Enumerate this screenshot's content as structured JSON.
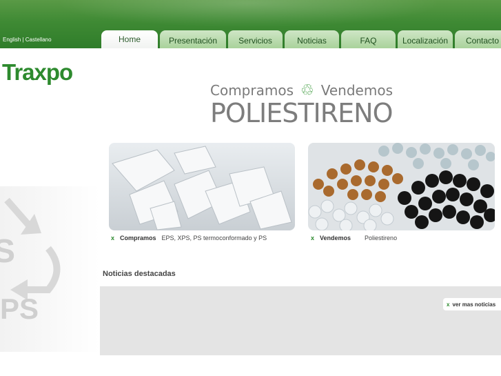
{
  "lang": {
    "english": "English",
    "sep": " | ",
    "castellano": "Castellano"
  },
  "tabs": [
    {
      "label": "Home",
      "active": true
    },
    {
      "label": "Presentación"
    },
    {
      "label": "Servicios"
    },
    {
      "label": "Noticias"
    },
    {
      "label": "FAQ"
    },
    {
      "label": "Localización"
    },
    {
      "label": "Contacto"
    }
  ],
  "logo": "Traxpo",
  "hero": {
    "buy": "Compramos",
    "sell": "Vendemos",
    "product": "POLIESTIRENO",
    "icon": "recycle-icon"
  },
  "cards": [
    {
      "bold": "Compramos",
      "text": "EPS, XPS, PS termoconformado y PS"
    },
    {
      "bold": "Vendemos",
      "text": "Poliestireno"
    }
  ],
  "news": {
    "title": "Noticias destacadas",
    "more": "ver mas noticias"
  },
  "watermark": {
    "top": "S",
    "bottom": "PS"
  },
  "colors": {
    "brand": "#2d8a2e",
    "header": "#3f8a34"
  }
}
